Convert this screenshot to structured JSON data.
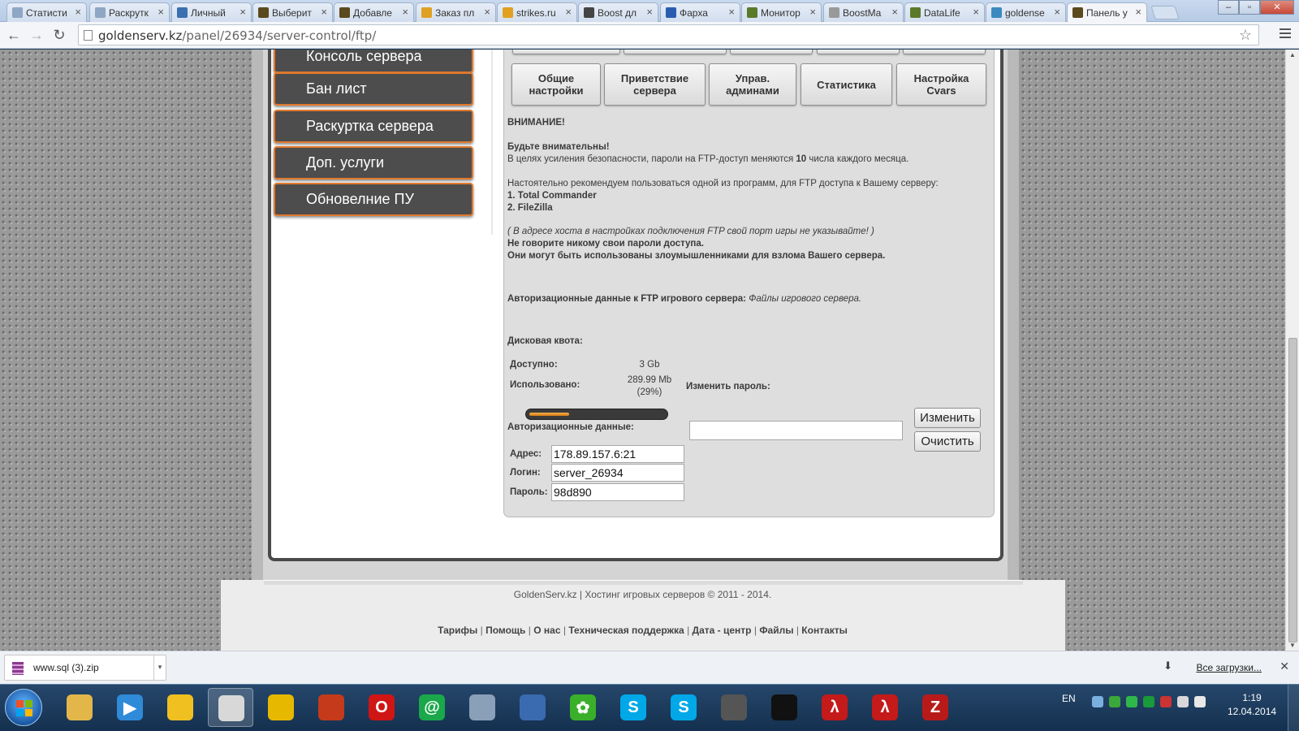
{
  "browser": {
    "tabs": [
      {
        "title": "Статисти",
        "color": "#8fa6c4"
      },
      {
        "title": "Раскрутк",
        "color": "#8fa6c4"
      },
      {
        "title": "Личный",
        "color": "#3b6fb0"
      },
      {
        "title": "Выберит",
        "color": "#5a4a1c"
      },
      {
        "title": "Добавле",
        "color": "#5a4a1c"
      },
      {
        "title": "Заказ пл",
        "color": "#e0a020"
      },
      {
        "title": "strikes.ru",
        "color": "#e0a020"
      },
      {
        "title": "Boost дл",
        "color": "#444444"
      },
      {
        "title": "Фарха",
        "color": "#2a5db0"
      },
      {
        "title": "Монитор",
        "color": "#5a7a2a"
      },
      {
        "title": "BoostMa",
        "color": "#999999"
      },
      {
        "title": "DataLife",
        "color": "#5a7a2a"
      },
      {
        "title": "goldense",
        "color": "#3a8ac0"
      },
      {
        "title": "Панель у",
        "color": "#5a4a1c"
      }
    ],
    "url_host": "goldenserv.kz",
    "url_path": "/panel/26934/server-control/ftp/",
    "back_icon": "arrow-left-icon",
    "forward_icon": "arrow-right-icon",
    "reload_icon": "reload-icon",
    "bookmark_icon": "star-icon",
    "menu_icon": "hamburger-menu-icon"
  },
  "sidebar": {
    "items": [
      {
        "label": "Консоль сервера"
      },
      {
        "label": "Бан лист"
      },
      {
        "label": "Раскуртка сервера"
      },
      {
        "label": "Доп. услуги"
      },
      {
        "label": "Обновелние ПУ"
      }
    ]
  },
  "panel": {
    "tabs": [
      {
        "line1": "Общие",
        "line2": "настройки"
      },
      {
        "line1": "Приветствие",
        "line2": "сервера"
      },
      {
        "line1": "Управ.",
        "line2": "админами"
      },
      {
        "line1": "Статистика",
        "line2": ""
      },
      {
        "line1": "Настройка",
        "line2": "Cvars"
      }
    ],
    "warning_title": "ВНИМАНИЕ!",
    "warning_bold": "Будьте внимательны!",
    "warning_text_pre": "В целях усиления безопасности, пароли на FTP-доступ меняются ",
    "warning_day": "10",
    "warning_text_post": " числа каждого месяца.",
    "recommend_text": "Настоятельно рекомендуем пользоваться одной из программ, для FTP доступа к Вашему серверу:",
    "programs": [
      "1. Total Commander",
      "2. FileZilla"
    ],
    "host_note": "( В адресе хоста в настройках подключения FTP свой порт игры не указывайте! )",
    "no_share": "Не говорите никому свои пароли доступа.",
    "misuse": "Они могут быть использованы злоумышленниками для взлома Вашего сервера.",
    "auth_heading": "Авторизационные данные к FTP игрового сервера:",
    "auth_heading_note": "Файлы игрового сервера.",
    "quota_heading": "Дисковая квота:",
    "available_label": "Доступно:",
    "available_value": "3 Gb",
    "used_label": "Использовано:",
    "used_value": "289.99",
    "used_unit": "Mb",
    "used_percent_text": "(29%)",
    "used_fraction": 0.29,
    "change_password_label": "Изменить пароль:",
    "auth_data_label": "Авторизационные данные:",
    "new_password_value": "",
    "change_button": "Изменить",
    "clear_button": "Очистить",
    "address_label": "Адрес:",
    "address_value": "178.89.157.6:21",
    "login_label": "Логин:",
    "login_value": "server_26934",
    "password_label": "Пароль:",
    "password_value": "98d890"
  },
  "footer": {
    "copyright": "GoldenServ.kz | Хостинг игровых серверов © 2011 - 2014.",
    "links": [
      "Тарифы",
      "Помощь",
      "О нас",
      "Техническая поддержка",
      "Дата - центр",
      "Файлы",
      "Контакты"
    ],
    "separator": "|"
  },
  "downloads": {
    "file_name": "www.sql (3).zip",
    "show_all": "Все загрузки...",
    "file_icon": "winrar-archive-icon",
    "close_icon": "close-icon"
  },
  "taskbar": {
    "apps": [
      {
        "name": "explorer-icon",
        "color": "#e3b64a",
        "glyph": ""
      },
      {
        "name": "media-player-icon",
        "color": "#2f8ad8",
        "glyph": "▶"
      },
      {
        "name": "bird-app-icon",
        "color": "#f0c020",
        "glyph": ""
      },
      {
        "name": "chrome-icon",
        "color": "#d8d8d8",
        "glyph": "",
        "active": true
      },
      {
        "name": "agent-app-icon",
        "color": "#e6b800",
        "glyph": ""
      },
      {
        "name": "game-app-icon",
        "color": "#c43a1a",
        "glyph": ""
      },
      {
        "name": "opera-icon",
        "color": "#d01515",
        "glyph": "O"
      },
      {
        "name": "mail-agent-icon",
        "color": "#1aa84a",
        "glyph": "@"
      },
      {
        "name": "network-app-icon",
        "color": "#8aa0b8",
        "glyph": ""
      },
      {
        "name": "remote-app-icon",
        "color": "#3a6ab0",
        "glyph": ""
      },
      {
        "name": "icq-icon",
        "color": "#3ab02a",
        "glyph": "✿"
      },
      {
        "name": "skype-icon",
        "color": "#00a8e8",
        "glyph": "S"
      },
      {
        "name": "skype-icon-2",
        "color": "#00a8e8",
        "glyph": "S"
      },
      {
        "name": "counter-strike-icon",
        "color": "#555555",
        "glyph": ""
      },
      {
        "name": "console-icon",
        "color": "#111111",
        "glyph": ""
      },
      {
        "name": "half-life-icon",
        "color": "#c41a1a",
        "glyph": "λ"
      },
      {
        "name": "half-life-icon-2",
        "color": "#c41a1a",
        "glyph": "λ"
      },
      {
        "name": "filezilla-icon",
        "color": "#b81a1a",
        "glyph": "Z"
      }
    ],
    "language": "EN",
    "time": "1:19",
    "date": "12.04.2014"
  }
}
